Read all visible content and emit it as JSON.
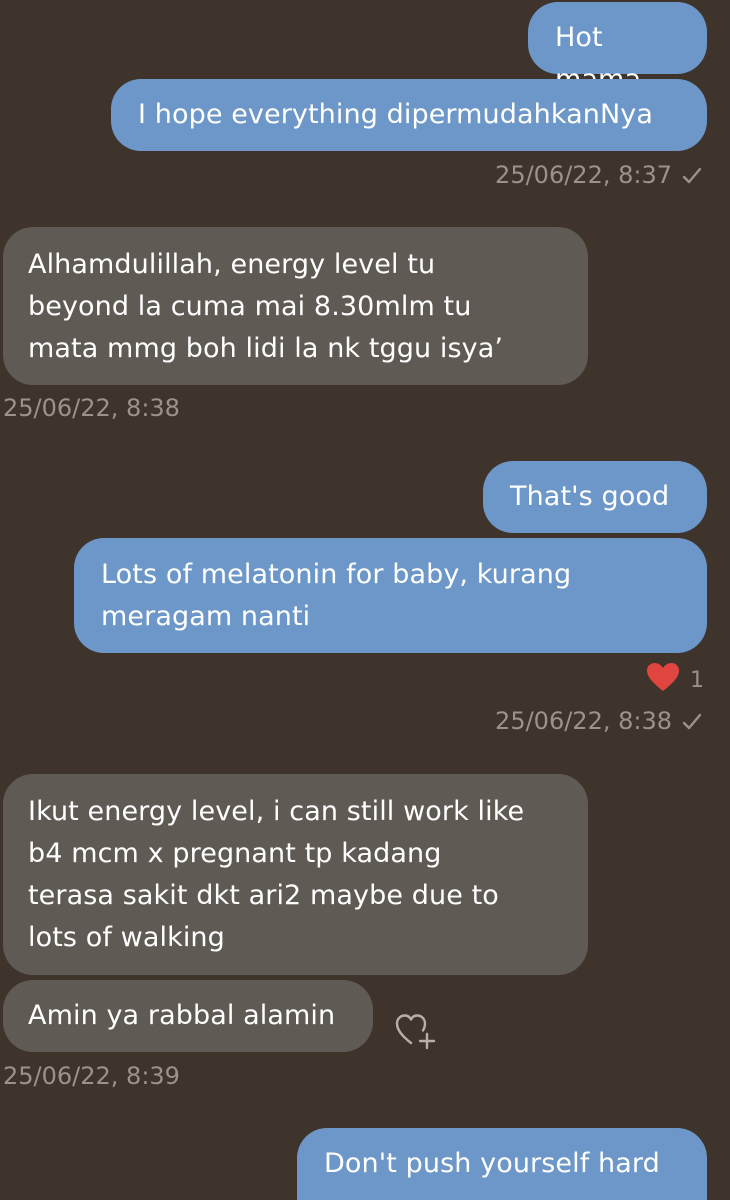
{
  "messages": [
    {
      "text": "Hot mama"
    },
    {
      "text": "I hope everything dipermudahkanNya"
    },
    {
      "text": "Alhamdulillah, energy level tu\nbeyond la cuma mai 8.30mlm tu\nmata mmg boh lidi la nk tggu isya’"
    },
    {
      "text": "That's good"
    },
    {
      "text": "Lots of melatonin for baby, kurang\nmeragam nanti"
    },
    {
      "text": "Ikut energy level, i can still work like\nb4 mcm x pregnant tp kadang\nterasa sakit dkt ari2 maybe due to\nlots of walking"
    },
    {
      "text": "Amin ya rabbal alamin"
    },
    {
      "text": "Don't push yourself hard"
    }
  ],
  "timestamps": {
    "t1": "25/06/22, 8:37",
    "t2": "25/06/22, 8:38",
    "t3": "25/06/22, 8:38",
    "t4": "25/06/22, 8:39"
  },
  "reactions": {
    "heart_count": "1",
    "heart_color": "#e0453f"
  },
  "colors": {
    "background": "#3e342c",
    "outgoing_bubble": "#6c97c8",
    "incoming_bubble": "#605a55",
    "meta_text": "#9b928a"
  },
  "icons": {
    "sent": "check-icon",
    "reaction": "heart-icon",
    "add_reaction": "add-reaction-icon"
  }
}
